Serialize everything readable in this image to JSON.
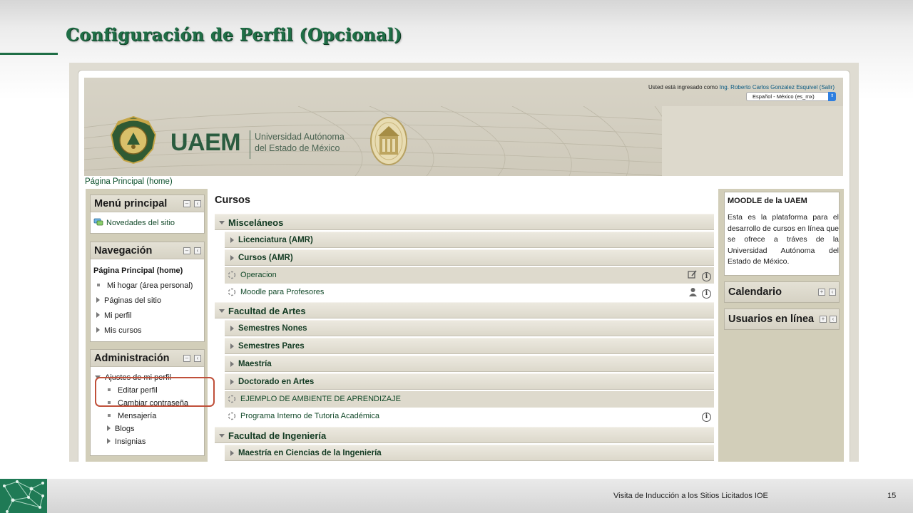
{
  "slide": {
    "title": "Configuración de Perfil (Opcional)",
    "footer_text": "Visita de Inducción a los Sitios Licitados IOE",
    "page_number": "15"
  },
  "header": {
    "login_prefix": "Usted está ingresado como",
    "login_user": "Ing. Roberto Carlos Gonzalez Esquivel (Salir)",
    "language": "Español - México (es_mx)",
    "logo_word": "UAEM",
    "logo_sub1": "Universidad Autónoma",
    "logo_sub2": "del Estado de México"
  },
  "breadcrumb": "Página Principal (home)",
  "left": {
    "menu": {
      "title": "Menú principal",
      "item": "Novedades del sitio"
    },
    "nav": {
      "title": "Navegación",
      "home": "Página Principal (home)",
      "items": [
        "Mi hogar (área personal)",
        "Páginas del sitio",
        "Mi perfil",
        "Mis cursos"
      ]
    },
    "admin": {
      "title": "Administración",
      "profile_settings": "Ajustes de mi perfil",
      "items": [
        "Editar perfil",
        "Cambiar contraseña",
        "Mensajería",
        "Blogs",
        "Insignias"
      ]
    }
  },
  "center": {
    "title": "Cursos",
    "rows": [
      {
        "kind": "cat",
        "label": "Misceláneos"
      },
      {
        "kind": "sub",
        "label": "Licenciatura (AMR)"
      },
      {
        "kind": "sub",
        "label": "Cursos (AMR)"
      },
      {
        "kind": "course",
        "label": "Operacion"
      },
      {
        "kind": "course",
        "label": "Moodle para Profesores"
      },
      {
        "kind": "cat",
        "label": "Facultad de Artes"
      },
      {
        "kind": "sub",
        "label": "Semestres Nones"
      },
      {
        "kind": "sub",
        "label": "Semestres Pares"
      },
      {
        "kind": "sub",
        "label": "Maestría"
      },
      {
        "kind": "sub",
        "label": "Doctorado en Artes"
      },
      {
        "kind": "course",
        "label": "EJEMPLO DE AMBIENTE DE APRENDIZAJE"
      },
      {
        "kind": "course",
        "label": "Programa Interno de Tutoría Académica"
      },
      {
        "kind": "cat",
        "label": "Facultad de Ingeniería"
      },
      {
        "kind": "sub",
        "label": "Maestría en Ciencias de la Ingeniería"
      }
    ]
  },
  "right": {
    "moodle_title": "MOODLE de la UAEM",
    "moodle_text": "Esta es la plataforma para el desarrollo de cursos en línea que se ofrece a tráves de la Universidad Autónoma del Estado de México.",
    "calendar_title": "Calendario",
    "users_title": "Usuarios en línea"
  },
  "colors": {
    "slide_green": "#1f6e46",
    "link_green": "#134a2a",
    "highlight_red": "#c0503a"
  }
}
